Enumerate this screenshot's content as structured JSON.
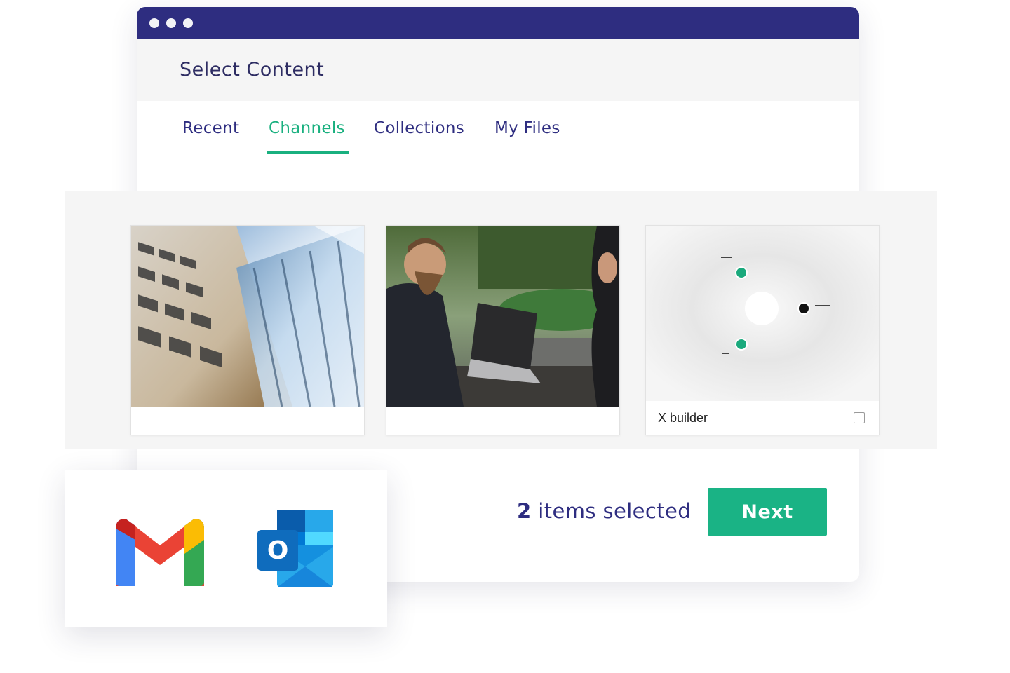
{
  "window": {
    "title": "Select Content",
    "titlebar_color": "#2e2d80"
  },
  "tabs": [
    {
      "label": "Recent",
      "active": false
    },
    {
      "label": "Channels",
      "active": true
    },
    {
      "label": "Collections",
      "active": false
    },
    {
      "label": "My Files",
      "active": false
    }
  ],
  "accent_color": "#1ab385",
  "cards": [
    {
      "image": "office-building-photo",
      "label": "",
      "selected": true
    },
    {
      "image": "business-meeting-laptop-photo",
      "label": "",
      "selected": true
    },
    {
      "image": "x-builder-diagram",
      "label": "X builder",
      "selected": false
    }
  ],
  "footer": {
    "selected_count": "2",
    "selected_text": "items selected",
    "next_label": "Next"
  },
  "integrations": [
    {
      "icon": "gmail-icon"
    },
    {
      "icon": "outlook-icon",
      "letter": "O"
    }
  ]
}
